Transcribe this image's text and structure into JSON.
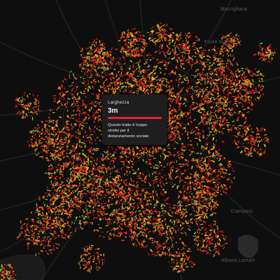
{
  "map": {
    "place_labels": {
      "north": "Marcigliana",
      "northeast": "Fonte Nuova",
      "southeast": "Ciampino",
      "south": "Albano Laziale"
    }
  },
  "tooltip": {
    "title": "Larghezza",
    "value": "3m",
    "message": "Questo tratto è troppo stretto per il distanziamento sociale",
    "bar_color": "#e0243a"
  },
  "colors": {
    "narrow": "#e02020",
    "medium": "#f07a18",
    "wide": "#f2c81e",
    "widest": "#7bc043",
    "water": "#1a1a1a",
    "background": "#0e0e0e"
  }
}
